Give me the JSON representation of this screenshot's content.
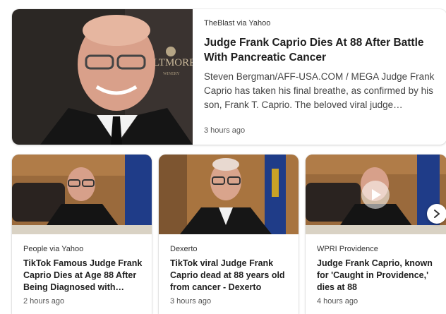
{
  "featured": {
    "source": "TheBlast via Yahoo",
    "title": "Judge Frank Caprio Dies At 88 After Battle With Pancreatic Cancer",
    "description": "Steven Bergman/AFF-USA.COM / MEGA Judge Frank Caprio has taken his final breathe, as confirmed by his son, Frank T. Caprio. The beloved viral judge…",
    "time": "3 hours ago",
    "image_backdrop_text": "BILTMORE",
    "image_backdrop_subtext": "WINERY"
  },
  "cards": [
    {
      "source": "People via Yahoo",
      "title": "TikTok Famous Judge Frank Caprio Dies at Age 88 After Being Diagnosed with…",
      "time": "2 hours ago"
    },
    {
      "source": "Dexerto",
      "title": "TikTok viral Judge Frank Caprio dead at 88 years old from cancer - Dexerto",
      "time": "3 hours ago"
    },
    {
      "source": "WPRI Providence",
      "title": "Judge Frank Caprio, known for 'Caught in Providence,' dies at 88",
      "time": "4 hours ago"
    }
  ],
  "icons": {
    "play": "play-icon",
    "next": "chevron-right-icon"
  },
  "colors": {
    "title": "#1f1f1f",
    "meta": "#555555",
    "card_bg": "#ffffff"
  }
}
